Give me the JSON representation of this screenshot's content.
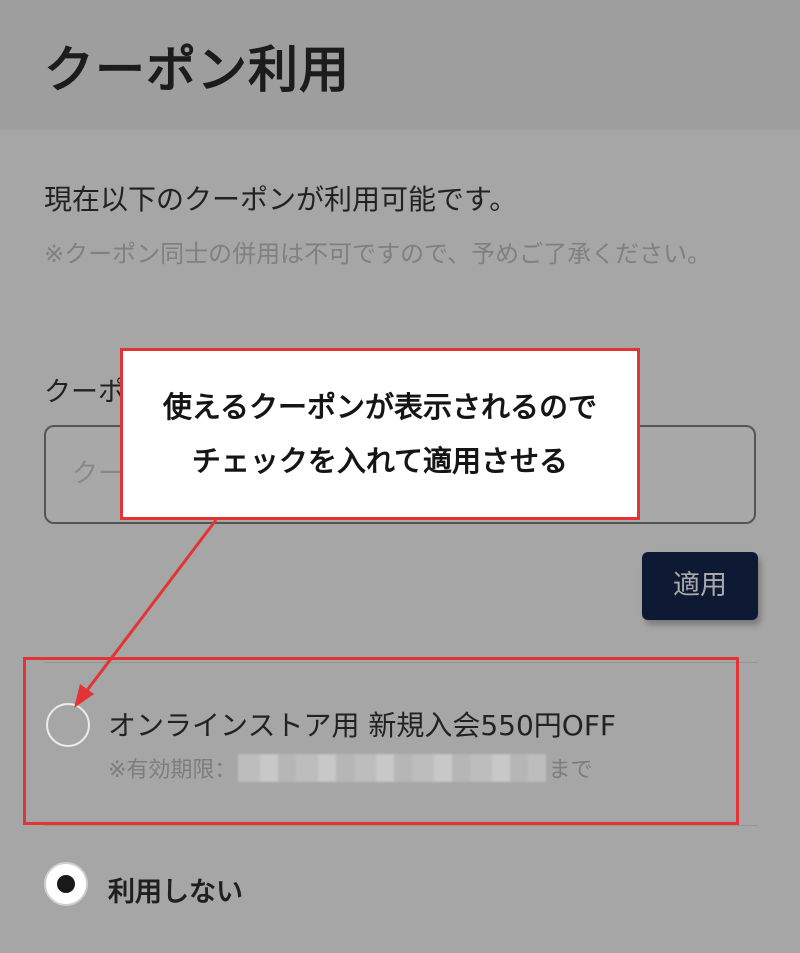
{
  "header": {
    "title": "クーポン利用"
  },
  "intro": {
    "text": "現在以下のクーポンが利用可能です。",
    "note": "※クーポン同士の併用は不可ですので、予めご了承ください。"
  },
  "code_form": {
    "label": "クーポ",
    "placeholder": "クー",
    "apply_label": "適用"
  },
  "coupons": [
    {
      "name": "オンラインストア用 新規入会550円OFF",
      "expiry_prefix": "※有効期限：",
      "expiry_suffix": "まで",
      "selected": false
    }
  ],
  "no_use": {
    "label": "利用しない",
    "selected": true
  },
  "annotation": {
    "line1": "使えるクーポンが表示されるので",
    "line2": "チェックを入れて適用させる",
    "color": "#e23434"
  }
}
